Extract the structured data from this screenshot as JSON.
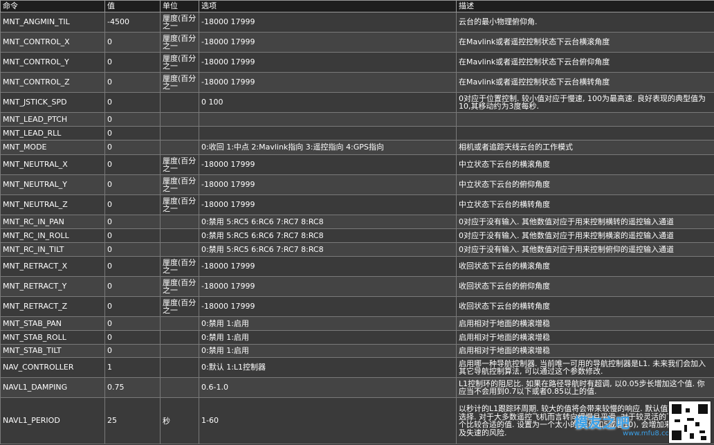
{
  "columns": [
    "命令",
    "值",
    "单位",
    "选项",
    "描述"
  ],
  "rows": [
    {
      "cmd": "MNT_ANGMIN_TIL",
      "val": "-4500",
      "unit": "厘度(百分之一",
      "opt": "-18000 17999",
      "desc": "云台的最小物理俯仰角."
    },
    {
      "cmd": "MNT_CONTROL_X",
      "val": "0",
      "unit": "厘度(百分之一",
      "opt": "-18000 17999",
      "desc": "在Mavlink或者遥控控制状态下云台横滚角度"
    },
    {
      "cmd": "MNT_CONTROL_Y",
      "val": "0",
      "unit": "厘度(百分之一",
      "opt": "-18000 17999",
      "desc": "在Mavlink或者遥控控制状态下云台俯仰角度"
    },
    {
      "cmd": "MNT_CONTROL_Z",
      "val": "0",
      "unit": "厘度(百分之一",
      "opt": "-18000 17999",
      "desc": "在Mavlink或者遥控控制状态下云台横转角度"
    },
    {
      "cmd": "MNT_JSTICK_SPD",
      "val": "0",
      "unit": "",
      "opt": "0 100",
      "desc": "0对应于位置控制. 较小值对应于慢速, 100为最高速. 良好表现的典型值为10,其移动约为3度每秒."
    },
    {
      "cmd": "MNT_LEAD_PTCH",
      "val": "0",
      "unit": "",
      "opt": "",
      "desc": ""
    },
    {
      "cmd": "MNT_LEAD_RLL",
      "val": "0",
      "unit": "",
      "opt": "",
      "desc": ""
    },
    {
      "cmd": "MNT_MODE",
      "val": "0",
      "unit": "",
      "opt": "0:收回 1:中点 2:Mavlink指向 3:遥控指向 4:GPS指向",
      "desc": "相机或者追踪天线云台的工作模式"
    },
    {
      "cmd": "MNT_NEUTRAL_X",
      "val": "0",
      "unit": "厘度(百分之一",
      "opt": "-18000 17999",
      "desc": "中立状态下云台的横滚角度"
    },
    {
      "cmd": "MNT_NEUTRAL_Y",
      "val": "0",
      "unit": "厘度(百分之一",
      "opt": "-18000 17999",
      "desc": "中立状态下云台的俯仰角度"
    },
    {
      "cmd": "MNT_NEUTRAL_Z",
      "val": "0",
      "unit": "厘度(百分之一",
      "opt": "-18000 17999",
      "desc": "中立状态下云台的横转角度"
    },
    {
      "cmd": "MNT_RC_IN_PAN",
      "val": "0",
      "unit": "",
      "opt": "0:禁用 5:RC5 6:RC6 7:RC7 8:RC8",
      "desc": "0对应于没有输入. 其他数值对应于用来控制横转的遥控输入通道"
    },
    {
      "cmd": "MNT_RC_IN_ROLL",
      "val": "0",
      "unit": "",
      "opt": "0:禁用 5:RC5 6:RC6 7:RC7 8:RC8",
      "desc": "0对应于没有输入. 其他数值对应于用来控制横滚的遥控输入通道"
    },
    {
      "cmd": "MNT_RC_IN_TILT",
      "val": "0",
      "unit": "",
      "opt": "0:禁用 5:RC5 6:RC6 7:RC7 8:RC8",
      "desc": "0对应于没有输入. 其他数值对应于用来控制俯仰的遥控输入通道"
    },
    {
      "cmd": "MNT_RETRACT_X",
      "val": "0",
      "unit": "厘度(百分之一",
      "opt": "-18000 17999",
      "desc": "收回状态下云台的横滚角度"
    },
    {
      "cmd": "MNT_RETRACT_Y",
      "val": "0",
      "unit": "厘度(百分之一",
      "opt": "-18000 17999",
      "desc": "收回状态下云台的俯仰角度"
    },
    {
      "cmd": "MNT_RETRACT_Z",
      "val": "0",
      "unit": "厘度(百分之一",
      "opt": "-18000 17999",
      "desc": "收回状态下云台的横转角度"
    },
    {
      "cmd": "MNT_STAB_PAN",
      "val": "0",
      "unit": "",
      "opt": "0:禁用 1:启用",
      "desc": "启用相对于地面的横滚增稳"
    },
    {
      "cmd": "MNT_STAB_ROLL",
      "val": "0",
      "unit": "",
      "opt": "0:禁用 1:启用",
      "desc": "启用相对于地面的横滚增稳"
    },
    {
      "cmd": "MNT_STAB_TILT",
      "val": "0",
      "unit": "",
      "opt": "0:禁用 1:启用",
      "desc": "启用相对于地面的横滚增稳"
    },
    {
      "cmd": "NAV_CONTROLLER",
      "val": "1",
      "unit": "",
      "opt": "0:默认 1:L1控制器",
      "desc": "启用哪一种导航控制器. 当前唯一可用的导航控制器是L1. 未来我们会加入其它导航控制算法, 可以通过这个参数修改."
    },
    {
      "cmd": "NAVL1_DAMPING",
      "val": "0.75",
      "unit": "",
      "opt": "0.6-1.0",
      "desc": "L1控制环的阻尼比. 如果在路径导航时有超调, 以0.05步长增加这个值. 你应当不会用到0.7以下或者0.85以上的值."
    },
    {
      "cmd": "NAVL1_PERIOD",
      "val": "25",
      "unit": "秒",
      "opt": "1-60",
      "desc": "以秒计的L1跟踪环周期. 较大的值将会带来较慢的响应. 默认值较为保守的选择. 对于大多数遥控飞机而言转向缓慢且平滑. 对于较灵活的飞机, 20是一个比较合适的值. 设置为一个太小的值(例如5或者10), 会增加来剧烈的控制及失速的风险."
    }
  ],
  "watermark": {
    "brand": "模友之吧",
    "sub": "www.mfu8.com"
  }
}
